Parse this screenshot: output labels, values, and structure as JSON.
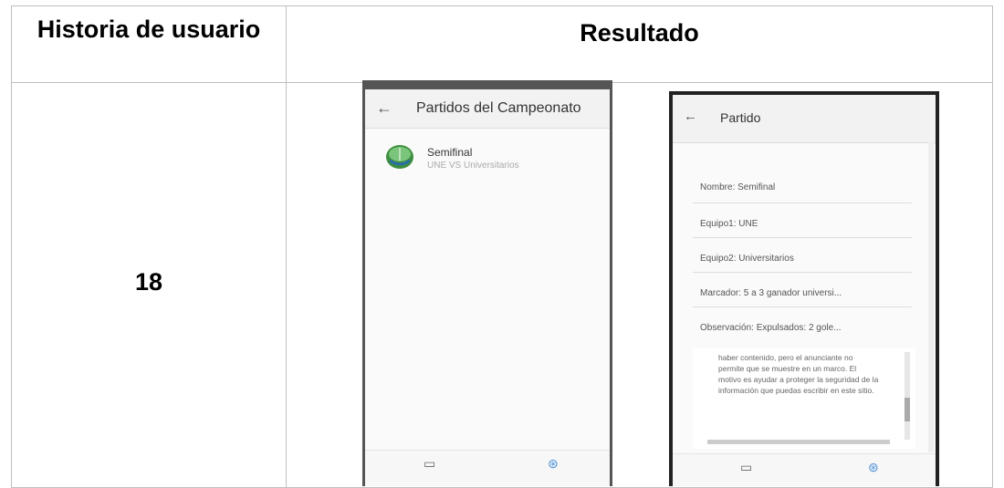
{
  "table": {
    "header_left": "Historia de usuario",
    "header_right": "Resultado",
    "story_number": "18"
  },
  "screen_list": {
    "title": "Partidos del Campeonato",
    "back_icon": "back-arrow-icon",
    "items": [
      {
        "title": "Semifinal",
        "subtitle": "UNE VS Universitarios",
        "icon": "football-field-icon"
      }
    ],
    "bottom_nav": [
      {
        "icon": "calendar-icon"
      },
      {
        "icon": "soccer-ball-icon"
      }
    ]
  },
  "screen_detail": {
    "title": "Partido",
    "back_icon": "back-arrow-icon",
    "fields": [
      "Nombre: Semifinal",
      "Equipo1: UNE",
      "Equipo2: Universitarios",
      "Marcador: 5 a 3 ganador universi...",
      "Observación: Expulsados: 2 gole..."
    ],
    "iframe_text": "haber contenido, pero el anunciante no permite que se muestre en un marco. El motivo es ayudar a proteger la seguridad de la información que puedas escribir en este sitio.",
    "bottom_nav": [
      {
        "icon": "calendar-icon"
      },
      {
        "icon": "soccer-ball-icon"
      }
    ]
  },
  "colors": {
    "accent": "#4a90d9",
    "field_green": "#3e8f3e"
  }
}
